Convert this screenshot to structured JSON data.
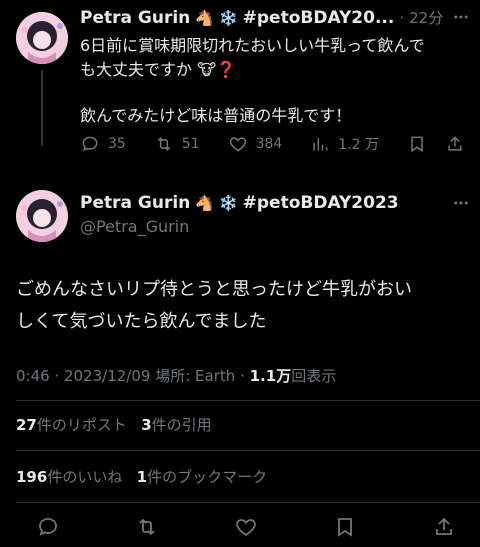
{
  "first_post": {
    "display_name": "Petra Gurin",
    "emoji_1": "🐴",
    "emoji_2": "❄️",
    "hashtag_truncated": "#petoBDAY20...",
    "separator": "·",
    "timestamp": "22分",
    "text_line1": "6日前に賞味期限切れたおいしい牛乳って飲んで",
    "text_line2": "も大丈夫ですか",
    "text_emoji_cow": "🐮",
    "text_emoji_q": "❓",
    "text_line3": "飲んでみたけど味は普通の牛乳です！",
    "metrics": {
      "replies": "35",
      "reposts": "51",
      "likes": "384",
      "views": "1.2 万"
    }
  },
  "main_post": {
    "display_name": "Petra Gurin",
    "emoji_1": "🐴",
    "emoji_2": "❄️",
    "hashtag": "#petoBDAY2023",
    "handle": "@Petra_Gurin",
    "text_line1": "ごめんなさいリプ待とうと思ったけど牛乳がおい",
    "text_line2": "しくて気づいたら飲んでました",
    "meta_time": "0:46 · 2023/12/09",
    "meta_location": "場所: Earth",
    "meta_views_num": "1.1万",
    "meta_views_label": "回表示"
  },
  "stats": {
    "reposts_num": "27",
    "reposts_label": "件のリポスト",
    "quotes_num": "3",
    "quotes_label": "件の引用",
    "likes_num": "196",
    "likes_label": "件のいいね",
    "bookmarks_num": "1",
    "bookmarks_label": "件のブックマーク"
  },
  "icons": {
    "more": "more-icon",
    "reply": "reply-icon",
    "repost": "repost-icon",
    "like": "heart-icon",
    "views": "views-icon",
    "bookmark": "bookmark-icon",
    "share": "share-icon"
  },
  "colors": {
    "background": "#000000",
    "text": "#e7e9ea",
    "muted": "#71767b",
    "divider": "#2f3336"
  }
}
